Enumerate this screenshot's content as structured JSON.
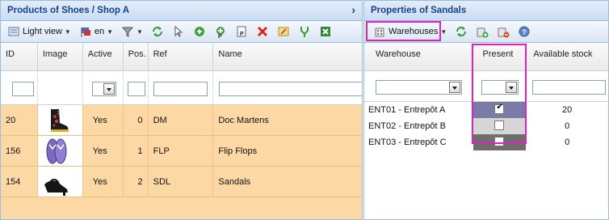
{
  "left_panel": {
    "title": "Products of Shoes / Shop A",
    "toolbar": {
      "view_label": "Light view",
      "lang_label": "en"
    },
    "columns": [
      "ID",
      "Image",
      "Active",
      "Pos.",
      "Ref",
      "Name"
    ],
    "rows": [
      {
        "id": "20",
        "image_icon": "boot-thumbnail",
        "active": "Yes",
        "pos": "0",
        "ref": "DM",
        "name": "Doc Martens"
      },
      {
        "id": "156",
        "image_icon": "flip-flop-thumbnail",
        "active": "Yes",
        "pos": "1",
        "ref": "FLP",
        "name": "Flip Flops"
      },
      {
        "id": "154",
        "image_icon": "sandal-thumbnail",
        "active": "Yes",
        "pos": "2",
        "ref": "SDL",
        "name": "Sandals"
      }
    ],
    "row_color": "#fcd9a4"
  },
  "right_panel": {
    "title": "Properties of Sandals",
    "toolbar": {
      "warehouses_label": "Warehouses"
    },
    "columns": [
      "Warehouse",
      "Present",
      "Available stock"
    ],
    "rows": [
      {
        "warehouse": "ENT01 - Entrepôt A",
        "present": true,
        "stock": "20",
        "present_bg": "#7b7ba8"
      },
      {
        "warehouse": "ENT02 - Entrepôt B",
        "present": false,
        "stock": "0",
        "present_bg": "#d6d6d6"
      },
      {
        "warehouse": "ENT03 - Entrepôt C",
        "present": false,
        "stock": "0",
        "present_bg": "#6e6e6e"
      }
    ]
  },
  "highlight_color": "#e020c0"
}
